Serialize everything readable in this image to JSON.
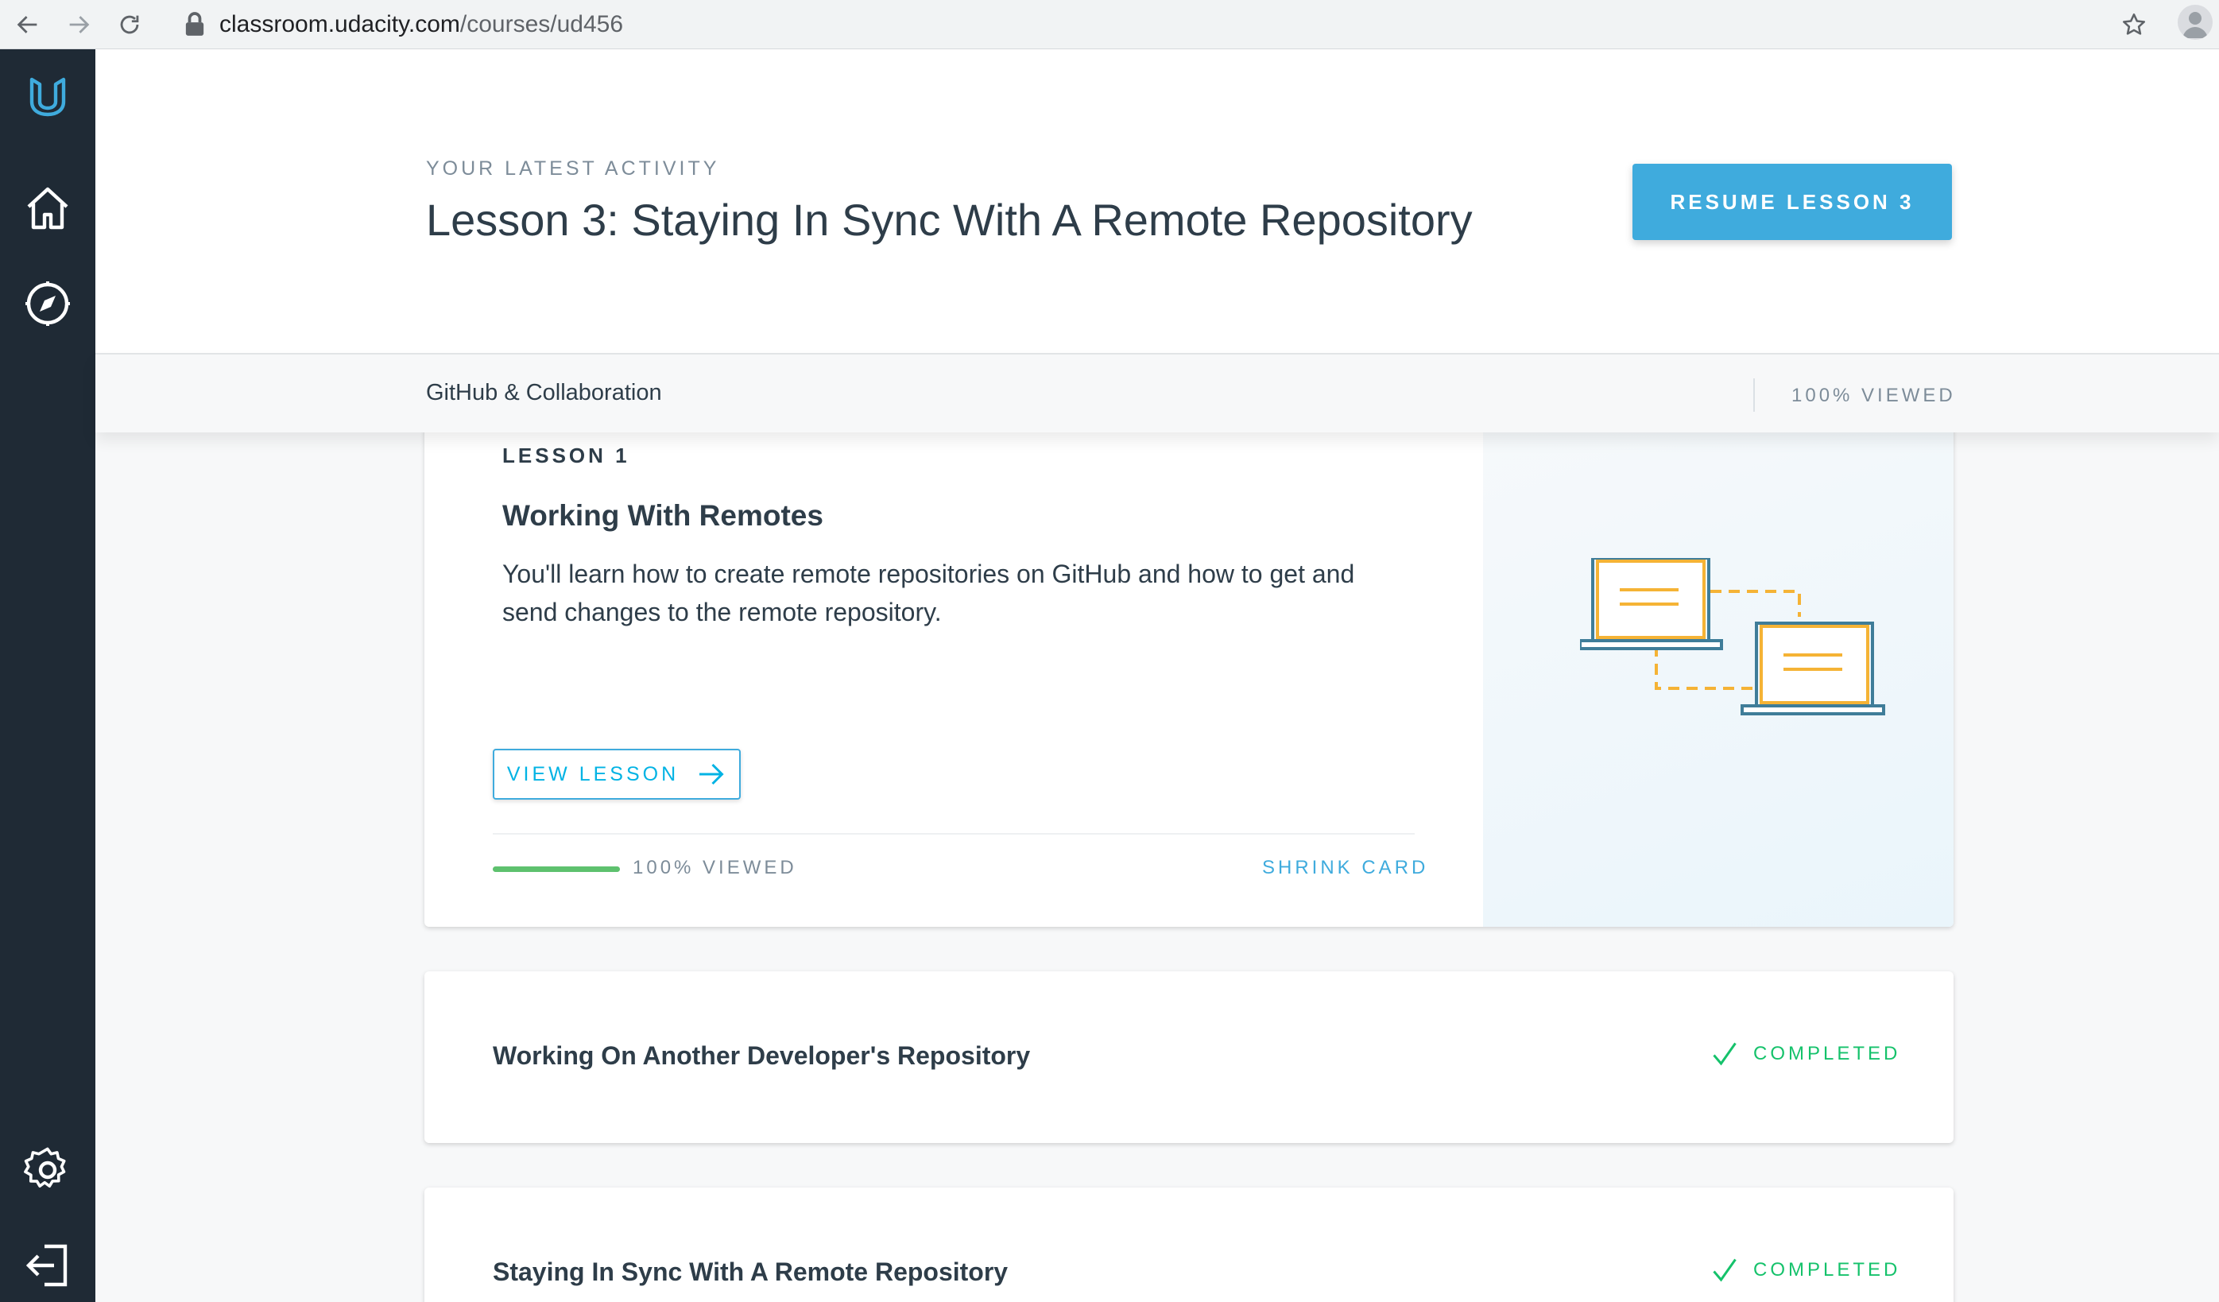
{
  "browser": {
    "url_domain": "classroom.udacity.com",
    "url_path": "/courses/ud456"
  },
  "sidebar": {
    "items": [
      {
        "icon": "udacity-logo-icon"
      },
      {
        "icon": "home-icon"
      },
      {
        "icon": "compass-icon"
      },
      {
        "icon": "gear-icon"
      },
      {
        "icon": "logout-icon"
      }
    ]
  },
  "header": {
    "eyebrow": "YOUR LATEST ACTIVITY",
    "title": "Lesson 3: Staying In Sync With A Remote Repository",
    "resume_label": "RESUME LESSON 3"
  },
  "course": {
    "name": "GitHub & Collaboration",
    "viewed": "100% VIEWED"
  },
  "lessons": [
    {
      "number": "LESSON 1",
      "title": "Working With Remotes",
      "description": "You'll learn how to create remote repositories on GitHub and how to get and send changes to the remote repository.",
      "view_label": "VIEW LESSON",
      "progress": 1.0,
      "progress_label": "100% VIEWED",
      "shrink_label": "SHRINK CARD"
    },
    {
      "title": "Working On Another Developer's Repository",
      "status": "COMPLETED"
    },
    {
      "title": "Staying In Sync With A Remote Repository",
      "status": "COMPLETED"
    }
  ],
  "colors": {
    "sidebar_bg": "#1f2a35",
    "accent": "#3fabdd",
    "completed": "#15c26b",
    "progress": "#5ec16e"
  }
}
